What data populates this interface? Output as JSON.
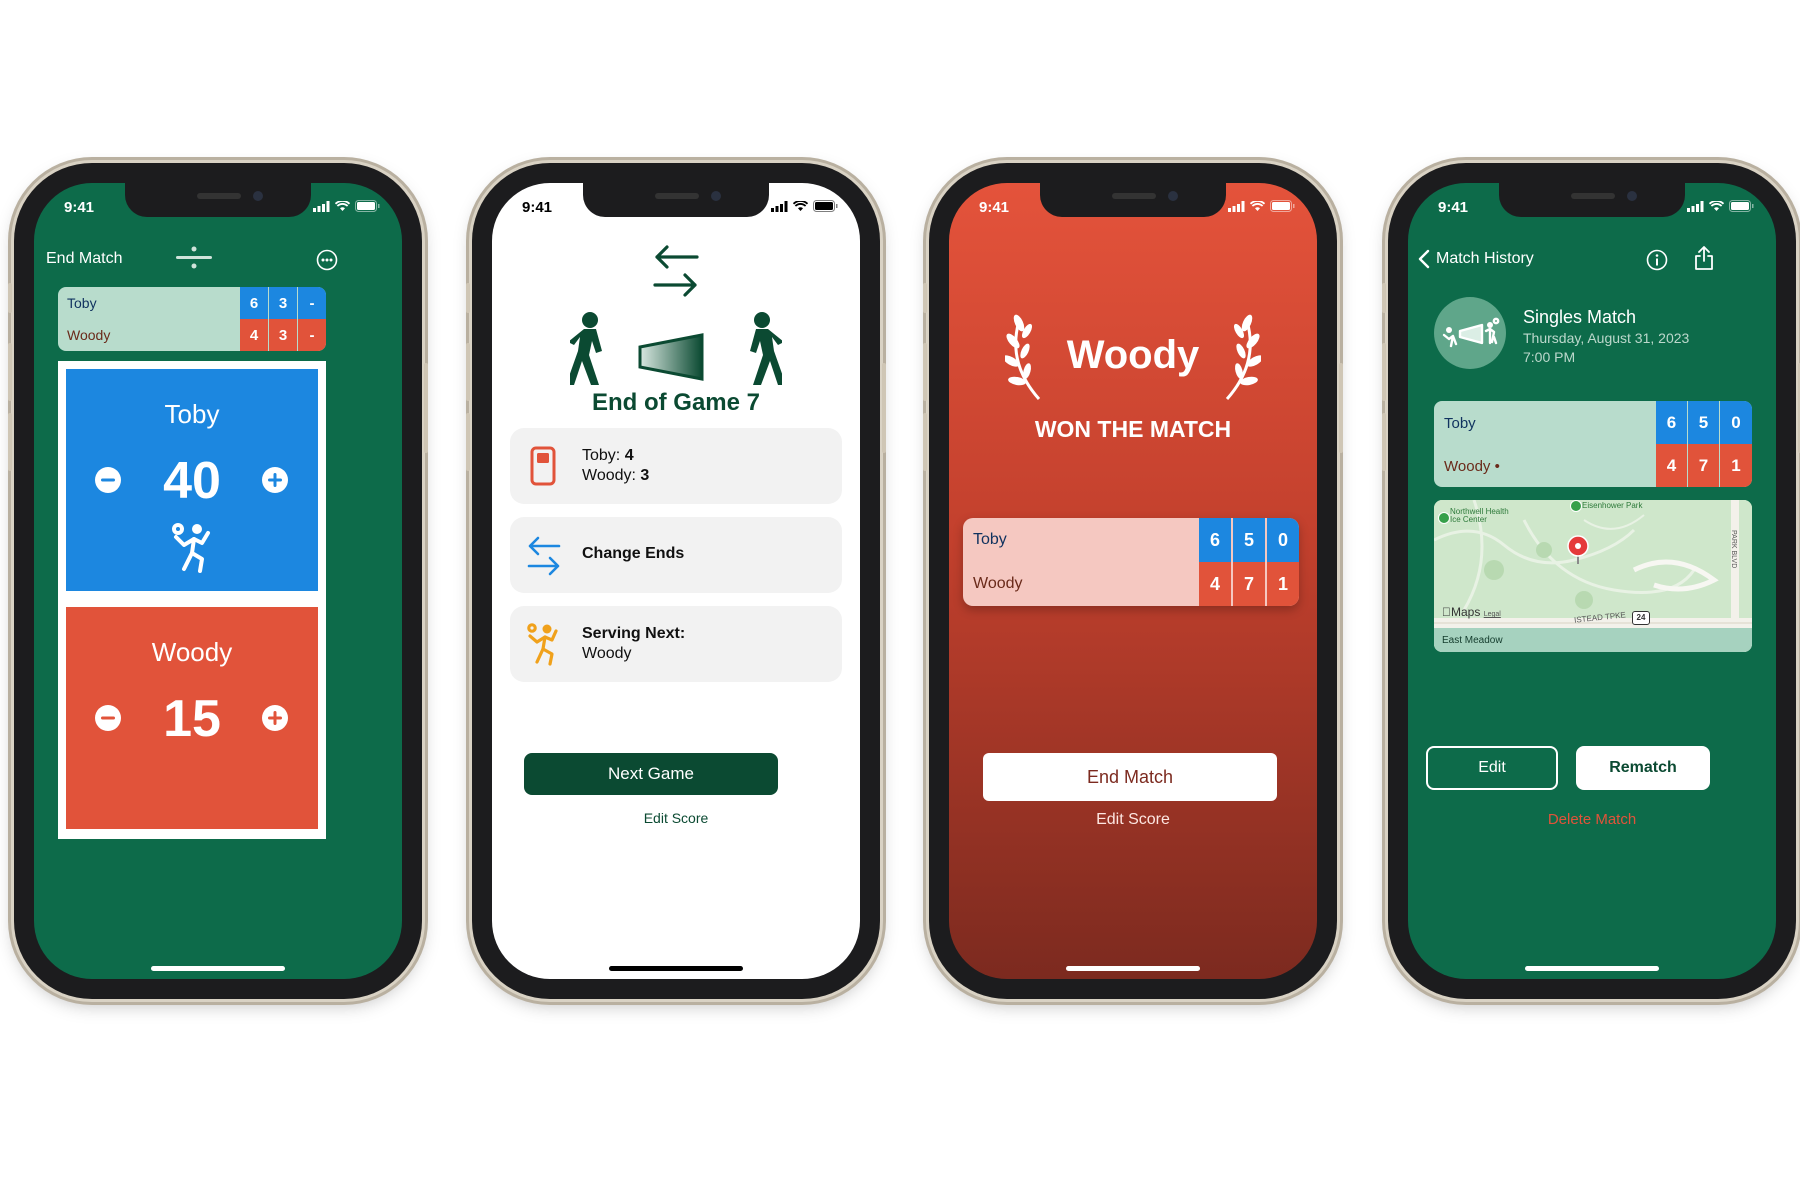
{
  "colors": {
    "green": "#0d6b4a",
    "dark_green": "#0b4a32",
    "blue": "#1c87e0",
    "red": "#e1533a",
    "mint": "#b8dccc",
    "white": "#ffffff"
  },
  "status": {
    "time": "9:41"
  },
  "screen1": {
    "header_left": "End Match",
    "mini_score": {
      "players": [
        {
          "name": "Toby",
          "sets": [
            "6",
            "3",
            "-"
          ]
        },
        {
          "name": "Woody",
          "sets": [
            "4",
            "3",
            "-"
          ]
        }
      ]
    },
    "panels": [
      {
        "name": "Toby",
        "points": "40"
      },
      {
        "name": "Woody",
        "points": "15"
      }
    ]
  },
  "screen2": {
    "title": "End of Game 7",
    "score_card": {
      "line1_label": "Toby: ",
      "line1_value": "4",
      "line2_label": "Woody: ",
      "line2_value": "3"
    },
    "change_ends": "Change Ends",
    "serving_next_label": "Serving Next:",
    "serving_next_value": "Woody",
    "next_game": "Next Game",
    "edit_score": "Edit Score"
  },
  "screen3": {
    "winner": "Woody",
    "subtitle": "WON THE MATCH",
    "score": {
      "players": [
        {
          "name": "Toby",
          "sets": [
            "6",
            "5",
            "0"
          ]
        },
        {
          "name": "Woody",
          "sets": [
            "4",
            "7",
            "1"
          ]
        }
      ]
    },
    "end_match": "End Match",
    "edit_score": "Edit Score"
  },
  "screen4": {
    "back": "Match History",
    "match_type": "Singles Match",
    "date": "Thursday, August 31, 2023",
    "time": "7:00 PM",
    "score": {
      "players": [
        {
          "name": "Toby",
          "sets": [
            "6",
            "5",
            "0"
          ]
        },
        {
          "name": "Woody •",
          "sets": [
            "4",
            "7",
            "1"
          ]
        }
      ]
    },
    "map": {
      "poi1": "Northwell Health",
      "poi1b": "Ice Center",
      "poi2": "Eisenhower Park",
      "road": "PARK BLVD",
      "road2": "ISTEAD TPKE",
      "route": "24",
      "brand": "Maps",
      "legal": "Legal",
      "location": "East Meadow"
    },
    "edit": "Edit",
    "rematch": "Rematch",
    "delete": "Delete Match"
  }
}
